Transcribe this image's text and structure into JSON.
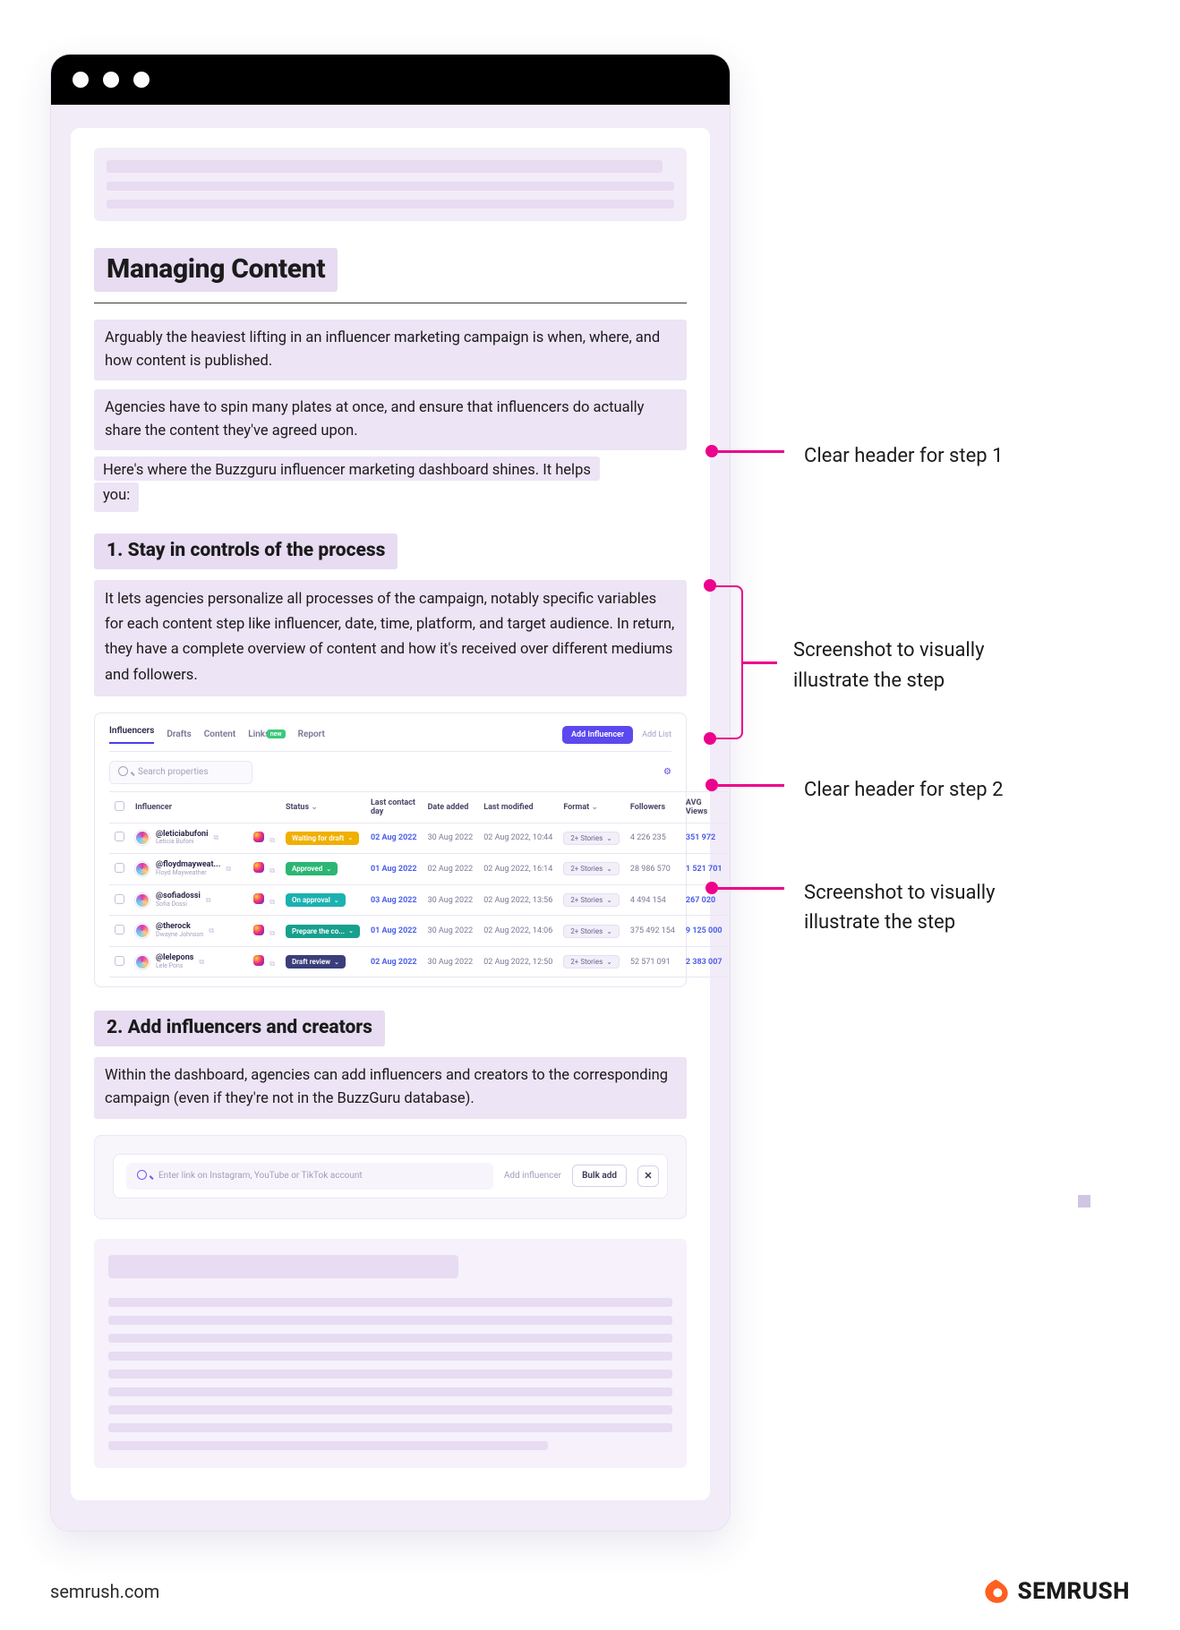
{
  "section_title": "Managing Content",
  "paragraphs": {
    "p1": "Arguably the heaviest lifting in an influencer marketing campaign is when, where, and how content is published.",
    "p2": "Agencies have to spin many plates at once, and ensure that influencers do actually share the content they've agreed upon.",
    "p3_l1": "Here's where the Buzzguru influencer marketing dashboard shines. It helps",
    "p3_l2": "you:"
  },
  "steps": {
    "s1_title": "1. Stay in controls of the process",
    "s1_body": "It lets agencies personalize all processes of the campaign, notably specific variables for each content step like influencer, date, time, platform, and target audience. In return, they have a complete overview of content and how it's received over different mediums and followers.",
    "s2_title": "2. Add influencers and creators",
    "s2_body": "Within the dashboard, agencies can add influencers and creators to the corresponding campaign (even if they're not in the BuzzGuru database)."
  },
  "dashboard": {
    "tabs": [
      "Influencers",
      "Drafts",
      "Content",
      "Links",
      "Report"
    ],
    "new_badge": "new",
    "add_btn": "Add Influencer",
    "add_list": "Add List",
    "search_placeholder": "Search properties",
    "columns": [
      "Influencer",
      "Status",
      "Last contact day",
      "Date added",
      "Last modified",
      "Format",
      "Followers",
      "AVG Views"
    ],
    "format_label": "2+ Stories",
    "rows": [
      {
        "handle": "@leticiabufoni",
        "name": "Leticia Bufoni",
        "status": "Waiting for draft",
        "status_color": "#f0b000",
        "contact": "02 Aug 2022",
        "added": "30 Aug 2022",
        "modified": "02 Aug 2022, 10:44",
        "followers": "4 226 235",
        "avg": "351 972"
      },
      {
        "handle": "@floydmayweat...",
        "name": "Floyd Mayweather",
        "status": "Approved",
        "status_color": "#2bb673",
        "contact": "01 Aug 2022",
        "added": "02 Aug 2022",
        "modified": "02 Aug 2022, 16:14",
        "followers": "28 986 570",
        "avg": "1 521 701"
      },
      {
        "handle": "@sofiadossi",
        "name": "Sofia Dossi",
        "status": "On approval",
        "status_color": "#1cb1b1",
        "contact": "03 Aug 2022",
        "added": "30 Aug 2022",
        "modified": "02 Aug 2022, 13:56",
        "followers": "4 494 154",
        "avg": "267 020"
      },
      {
        "handle": "@therock",
        "name": "Dwayne Johnson",
        "status": "Prepare the co...",
        "status_color": "#18a08e",
        "contact": "01 Aug 2022",
        "added": "30 Aug 2022",
        "modified": "02 Aug 2022, 14:06",
        "followers": "375 492 154",
        "avg": "9 125 000"
      },
      {
        "handle": "@lelepons",
        "name": "Lele Pons",
        "status": "Draft review",
        "status_color": "#3a3e7a",
        "contact": "02 Aug 2022",
        "added": "30 Aug 2022",
        "modified": "02 Aug 2022, 12:50",
        "followers": "52 571 091",
        "avg": "2 383 007"
      }
    ]
  },
  "addbar": {
    "placeholder": "Enter link on Instagram, YouTube or TikTok account",
    "add": "Add influencer",
    "bulk": "Bulk add"
  },
  "annotations": {
    "a1": "Clear header for step 1",
    "a2_l1": "Screenshot to visually",
    "a2_l2": "illustrate the step",
    "a3": "Clear header for step 2",
    "a4_l1": "Screenshot to visually",
    "a4_l2": "illustrate the step"
  },
  "footer": {
    "domain": "semrush.com",
    "brand": "SEMRUSH"
  }
}
